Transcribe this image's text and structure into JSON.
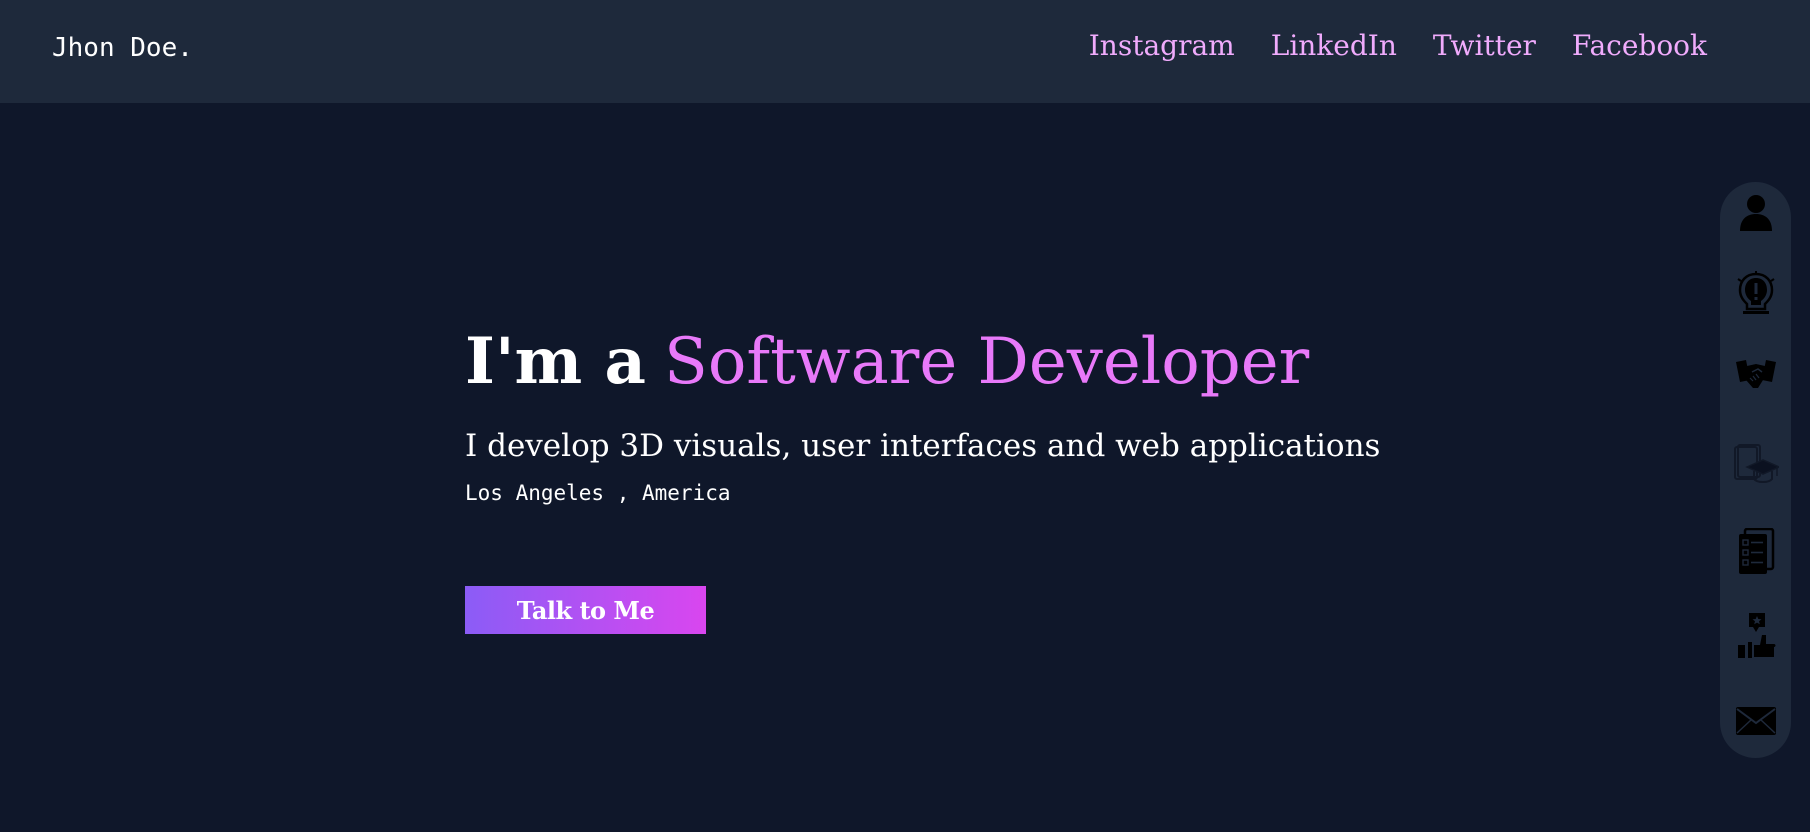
{
  "header": {
    "brand": "Jhon Doe.",
    "nav": [
      {
        "label": "Instagram"
      },
      {
        "label": "LinkedIn"
      },
      {
        "label": "Twitter"
      },
      {
        "label": "Facebook"
      }
    ]
  },
  "hero": {
    "headline_lead": "I'm a",
    "headline_role": "Software Developer",
    "tagline": "I develop 3D visuals, user interfaces and web applications",
    "location": "Los Angeles , America",
    "cta_label": "Talk to Me"
  },
  "side_dock": {
    "icons": [
      "user-icon",
      "idea-icon",
      "handshake-icon",
      "education-icon",
      "checklist-icon",
      "review-icon",
      "mail-icon"
    ]
  },
  "colors": {
    "page_bg": "#0f172a",
    "nav_bg": "#1e293b",
    "nav_link": "#f0abfc",
    "accent": "#e879f9",
    "cta_gradient_start": "#8b5cf6",
    "cta_gradient_end": "#d946ef"
  }
}
